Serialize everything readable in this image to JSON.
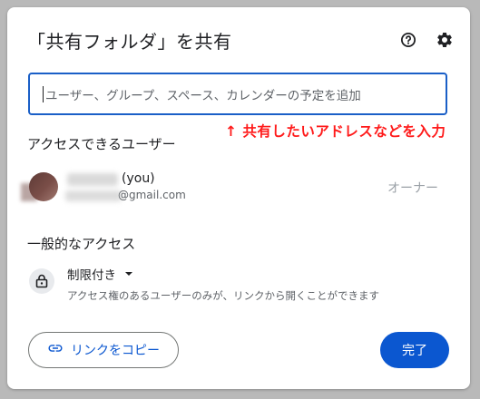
{
  "dialog": {
    "title": "「共有フォルダ」を共有",
    "help_icon": "help-circle-icon",
    "settings_icon": "gear-icon"
  },
  "share_input": {
    "placeholder": "ユーザー、グループ、スペース、カレンダーの予定を追加"
  },
  "annotation": {
    "text": "↑ 共有したいアドレスなどを入力",
    "color": "#ff1a1a"
  },
  "people_section": {
    "heading": "アクセスできるユーザー",
    "users": [
      {
        "name_suffix": "(you)",
        "email_suffix": "@gmail.com",
        "role": "オーナー"
      }
    ]
  },
  "general_access": {
    "heading": "一般的なアクセス",
    "icon": "lock-icon",
    "selected": "制限付き",
    "description": "アクセス権のあるユーザーのみが、リンクから開くことができます"
  },
  "footer": {
    "copy_link_label": "リンクをコピー",
    "copy_link_icon": "link-icon",
    "done_label": "完了"
  },
  "colors": {
    "accent": "#0b57d0",
    "input_border": "#1a5fc7",
    "background_overlay": "#b9b9b9"
  }
}
